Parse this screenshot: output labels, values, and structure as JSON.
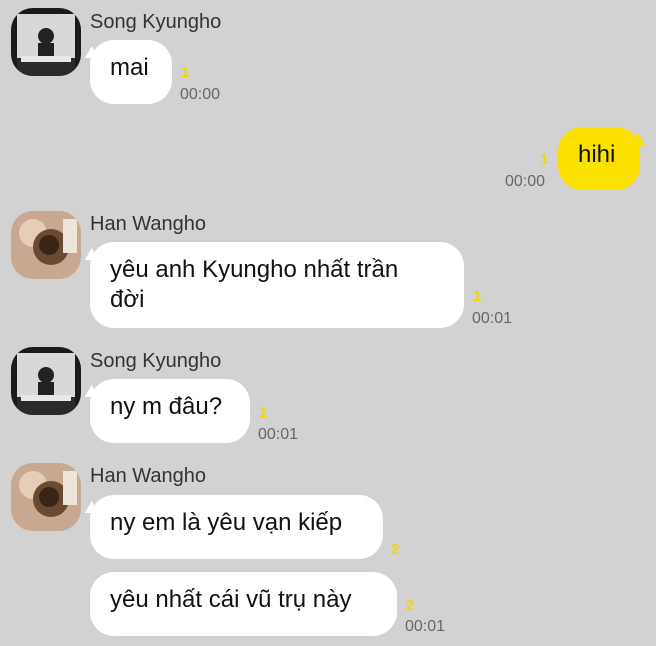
{
  "colors": {
    "background": "#d2d2d2",
    "my_bubble": "#fae100",
    "their_bubble": "#ffffff",
    "unread_count": "#f2d600"
  },
  "messages": [
    {
      "sender": "Song Kyungho",
      "text": "mai",
      "unread": "1",
      "time": "00:00"
    },
    {
      "sender": "me",
      "text": "hihi",
      "unread": "1",
      "time": "00:00"
    },
    {
      "sender": "Han Wangho",
      "text_line1": "yêu anh Kyungho nhất trần",
      "text_line2": "đời",
      "unread": "1",
      "time": "00:01"
    },
    {
      "sender": "Song Kyungho",
      "text": "ny m đâu?",
      "unread": "1",
      "time": "00:01"
    },
    {
      "sender": "Han Wangho",
      "text": "ny em là yêu vạn kiếp",
      "unread": "2"
    },
    {
      "sender": "Han Wangho",
      "text": "yêu nhất cái vũ trụ này",
      "unread": "2",
      "time": "00:01"
    }
  ]
}
